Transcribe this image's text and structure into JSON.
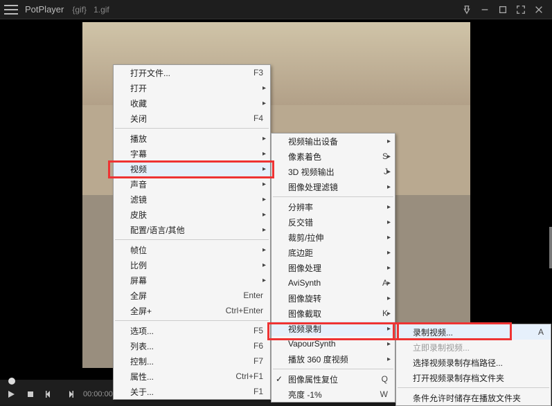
{
  "titlebar": {
    "app": "PotPlayer",
    "meta1": "{gif}",
    "meta2": "1.gif"
  },
  "controls": {
    "time": "00:00:00"
  },
  "menu1": {
    "openFile": "打开文件...",
    "openFile_sc": "F3",
    "open": "打开",
    "favorites": "收藏",
    "close": "关闭",
    "close_sc": "F4",
    "playback": "播放",
    "subtitle": "字幕",
    "video": "视频",
    "audio": "声音",
    "filter": "滤镜",
    "skin": "皮肤",
    "config": "配置/语言/其他",
    "fps": "帧位",
    "ratio": "比例",
    "screen": "屏幕",
    "fullscreen": "全屏",
    "fullscreen_sc": "Enter",
    "fullscreenPlus": "全屏+",
    "fullscreenPlus_sc": "Ctrl+Enter",
    "options": "选项...",
    "options_sc": "F5",
    "playlist": "列表...",
    "playlist_sc": "F6",
    "control": "控制...",
    "control_sc": "F7",
    "properties": "属性...",
    "properties_sc": "Ctrl+F1",
    "about": "关于...",
    "about_sc": "F1"
  },
  "menu2": {
    "outputDevice": "视频输出设备",
    "pixelShader": "像素着色",
    "pixelShader_sc": "S",
    "output3d": "3D 视频输出",
    "output3d_sc": "J",
    "imageFilter": "图像处理滤镜",
    "resolution": "分辨率",
    "deinterlace": "反交错",
    "cropStretch": "裁剪/拉伸",
    "margin": "底边距",
    "imageProc": "图像处理",
    "avisynth": "AviSynth",
    "avisynth_sc": "A",
    "rotate": "图像旋转",
    "capture": "图像截取",
    "capture_sc": "K",
    "record": "视频录制",
    "vapoursynth": "VapourSynth",
    "play360": "播放 360 度视频",
    "resetProps": "图像属性复位",
    "resetProps_sc": "Q",
    "brightness": "亮度 -1%",
    "brightness_sc": "W"
  },
  "menu3": {
    "recordVideo": "录制视频...",
    "recordVideo_sc": "A",
    "recordNow": "立即录制视频...",
    "selectPath": "选择视频录制存档路径...",
    "openPath": "打开视频录制存档文件夹",
    "allowPlayFolder": "条件允许时储存在播放文件夹"
  }
}
